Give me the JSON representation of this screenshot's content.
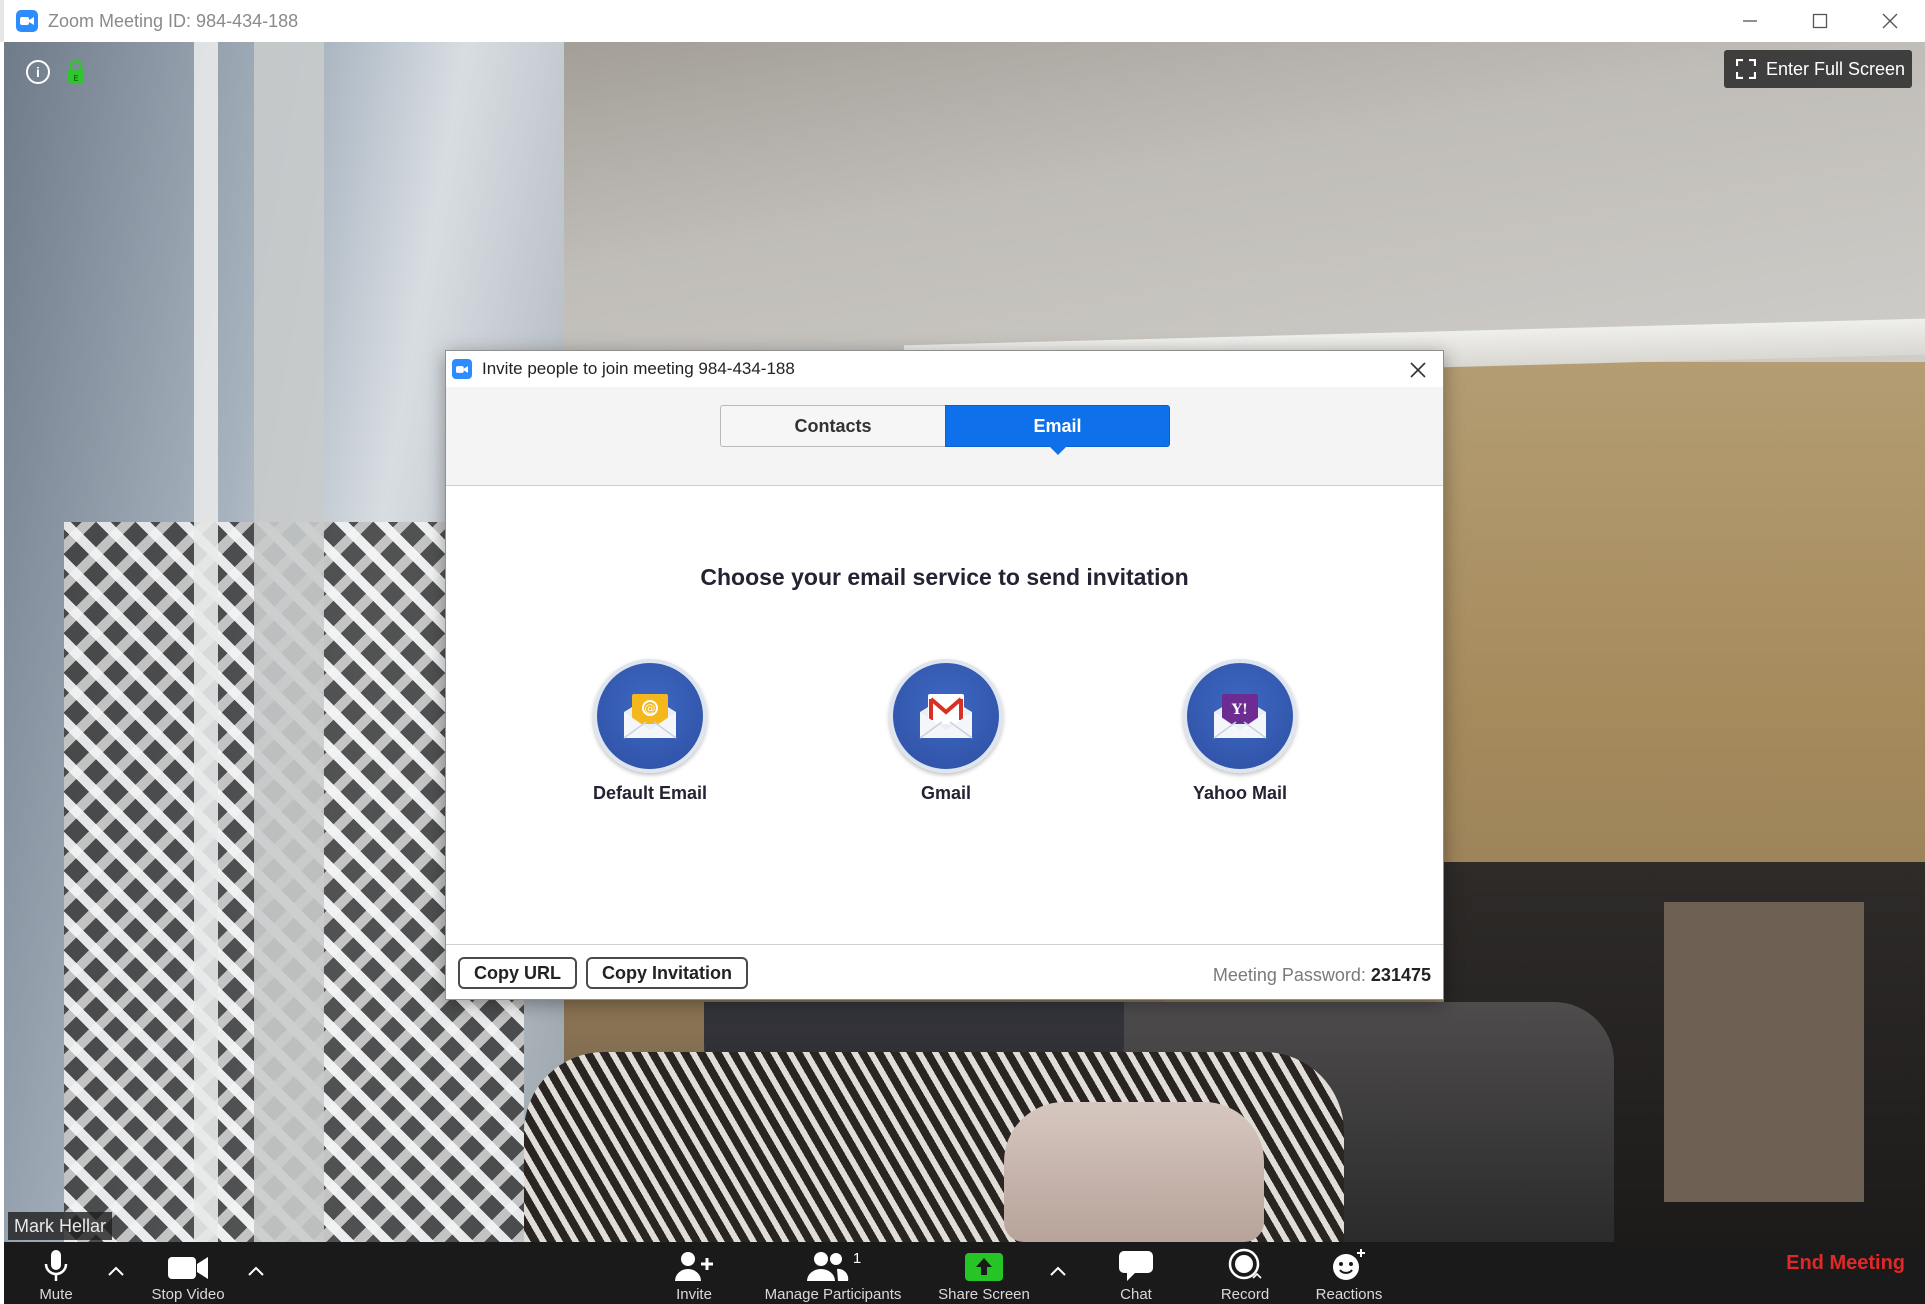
{
  "window": {
    "title": "Zoom Meeting ID: 984-434-188"
  },
  "video": {
    "fullscreen_label": "Enter Full Screen",
    "participant_name": "Mark Hellar"
  },
  "dialog": {
    "title": "Invite people to join meeting 984-434-188",
    "tabs": [
      {
        "label": "Contacts",
        "active": false
      },
      {
        "label": "Email",
        "active": true
      }
    ],
    "heading": "Choose your email service to send invitation",
    "services": [
      {
        "label": "Default Email",
        "icon": "default-email-icon"
      },
      {
        "label": "Gmail",
        "icon": "gmail-icon"
      },
      {
        "label": "Yahoo Mail",
        "icon": "yahoo-mail-icon"
      }
    ],
    "footer": {
      "copy_url": "Copy URL",
      "copy_invitation": "Copy Invitation",
      "password_label": "Meeting Password:",
      "password_value": "231475"
    }
  },
  "toolbar": {
    "items": [
      {
        "label": "Mute",
        "icon": "microphone-icon"
      },
      {
        "label": "Stop Video",
        "icon": "video-camera-icon"
      },
      {
        "label": "Invite",
        "icon": "add-person-icon"
      },
      {
        "label": "Manage Participants",
        "icon": "participants-icon",
        "count": "1"
      },
      {
        "label": "Share Screen",
        "icon": "share-screen-icon"
      },
      {
        "label": "Chat",
        "icon": "chat-icon"
      },
      {
        "label": "Record",
        "icon": "record-icon"
      },
      {
        "label": "Reactions",
        "icon": "reactions-icon"
      }
    ],
    "end_meeting": "End Meeting"
  },
  "colors": {
    "accent": "#0e71eb",
    "zoom_blue": "#2d8cff",
    "share_green": "#25c525",
    "end_red": "#e02828"
  }
}
